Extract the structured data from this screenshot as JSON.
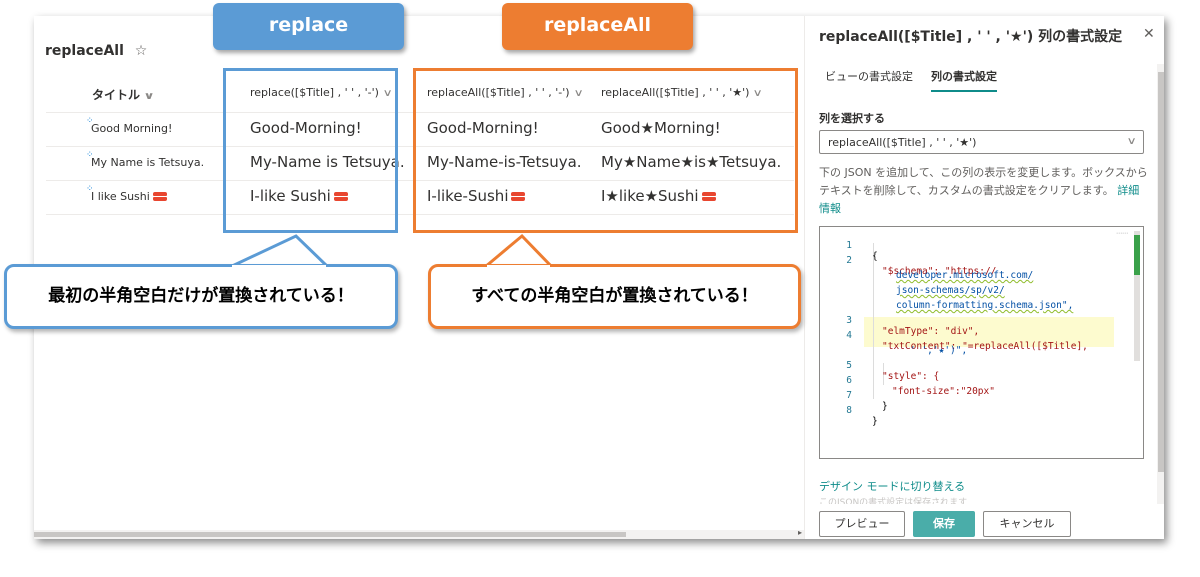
{
  "list": {
    "title": "replaceAll",
    "columns": [
      "タイトル",
      "replace([$Title] , ' ' , '-')",
      "replaceAll([$Title] , ' ' , '-')",
      "replaceAll([$Title] , ' ' , '★')"
    ],
    "rows": [
      {
        "title": "Good Morning!",
        "replace": "Good-Morning!",
        "replace_all_dash": "Good-Morning!",
        "replace_all_star": "Good★Morning!"
      },
      {
        "title": "My Name is Tetsuya.",
        "replace": "My-Name is Tetsuya.",
        "replace_all_dash": "My-Name-is-Tetsuya.",
        "replace_all_star": "My★Name★is★Tetsuya."
      },
      {
        "title": "I like Sushi",
        "replace": "I-like Sushi",
        "replace_all_dash": "I-like-Sushi",
        "replace_all_star": "I★like★Sushi"
      }
    ]
  },
  "panel": {
    "title": "replaceAll([$Title] , ' ' , '★') 列の書式設定",
    "tabs": [
      "ビューの書式設定",
      "列の書式設定"
    ],
    "active_tab": "列の書式設定",
    "select_label": "列を選択する",
    "select_value": "replaceAll([$Title] , ' ' , '★')",
    "description": "下の JSON を追加して、この列の表示を変更します。ボックスからテキストを削除して、カスタムの書式設定をクリアします。",
    "learn_more": "詳細情報",
    "design_mode_link": "デザイン モードに切り替える",
    "faded_note": "このJSONの書式設定は保存されます",
    "buttons": {
      "preview": "プレビュー",
      "save": "保存",
      "cancel": "キャンセル"
    },
    "code_lines": [
      {
        "n": "1",
        "text": "{"
      },
      {
        "n": "2",
        "text": "\"$schema\": \"https://"
      },
      {
        "n": "",
        "text": "developer.microsoft.com/"
      },
      {
        "n": "",
        "text": "json-schemas/sp/v2/"
      },
      {
        "n": "",
        "text": "column-formatting.schema.json\","
      },
      {
        "n": "3",
        "text": "\"elmType\": \"div\","
      },
      {
        "n": "4",
        "text": "\"txtContent\": \"=replaceAll([$Title],"
      },
      {
        "n": "",
        "text": "' ','★')\","
      },
      {
        "n": "5",
        "text": "\"style\": {"
      },
      {
        "n": "6",
        "text": "\"font-size\":\"20px\""
      },
      {
        "n": "7",
        "text": "}"
      },
      {
        "n": "8",
        "text": "}"
      }
    ]
  },
  "annotations": {
    "replace_label": "replace",
    "replaceall_label": "replaceAll",
    "callout_replace": "最初の半角空白だけが置換されている！",
    "callout_replaceall": "すべての半角空白が置換されている！"
  },
  "colors": {
    "blue": "#5b9bd5",
    "orange": "#ed7d31",
    "teal": "#0f8c8a",
    "save_bg": "#4aada9"
  },
  "icons": [
    "star-outline-icon",
    "chevron-down-icon",
    "new-item-icon",
    "sushi-emoji-icon",
    "close-icon"
  ]
}
